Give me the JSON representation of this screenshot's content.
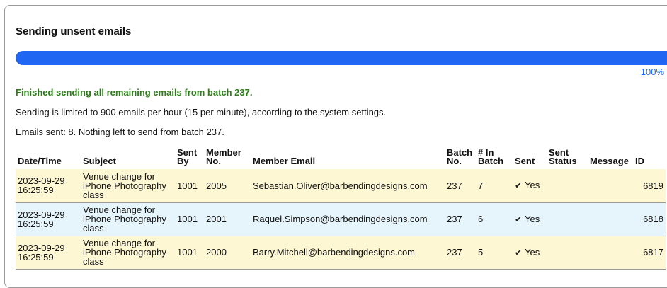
{
  "title": "Sending unsent emails",
  "progress": {
    "percent": 100,
    "label": "100%"
  },
  "status_message": "Finished sending all remaining emails from batch 237.",
  "rate_info": "Sending is limited to 900 emails per hour (15 per minute), according to the system settings.",
  "sent_info": "Emails sent: 8. Nothing left to send from batch 237.",
  "colors": {
    "progress": "#1f67f2",
    "success_text": "#2c7a19",
    "row_yellow": "#fdf7d4",
    "row_blue": "#e6f4fb"
  },
  "table": {
    "headers": {
      "date_time": "Date/Time",
      "subject": "Subject",
      "sent_by": "Sent By",
      "member_no": "Member No.",
      "member_email": "Member Email",
      "batch_no": "Batch No.",
      "in_batch": "# In Batch",
      "sent": "Sent",
      "sent_status": "Sent Status",
      "message": "Message",
      "id": "ID"
    },
    "rows": [
      {
        "date_time": "2023-09-29 16:25:59",
        "subject": "Venue change for iPhone Photography class",
        "sent_by": "1001",
        "member_no": "2005",
        "member_email": "Sebastian.Oliver@barbendingdesigns.com",
        "batch_no": "237",
        "in_batch": "7",
        "sent_icon": "check-icon",
        "sent": "Yes",
        "sent_status": "",
        "message": "",
        "id": "6819"
      },
      {
        "date_time": "2023-09-29 16:25:59",
        "subject": "Venue change for iPhone Photography class",
        "sent_by": "1001",
        "member_no": "2001",
        "member_email": "Raquel.Simpson@barbendingdesigns.com",
        "batch_no": "237",
        "in_batch": "6",
        "sent_icon": "check-icon",
        "sent": "Yes",
        "sent_status": "",
        "message": "",
        "id": "6818"
      },
      {
        "date_time": "2023-09-29 16:25:59",
        "subject": "Venue change for iPhone Photography class",
        "sent_by": "1001",
        "member_no": "2000",
        "member_email": "Barry.Mitchell@barbendingdesigns.com",
        "batch_no": "237",
        "in_batch": "5",
        "sent_icon": "check-icon",
        "sent": "Yes",
        "sent_status": "",
        "message": "",
        "id": "6817"
      }
    ]
  }
}
